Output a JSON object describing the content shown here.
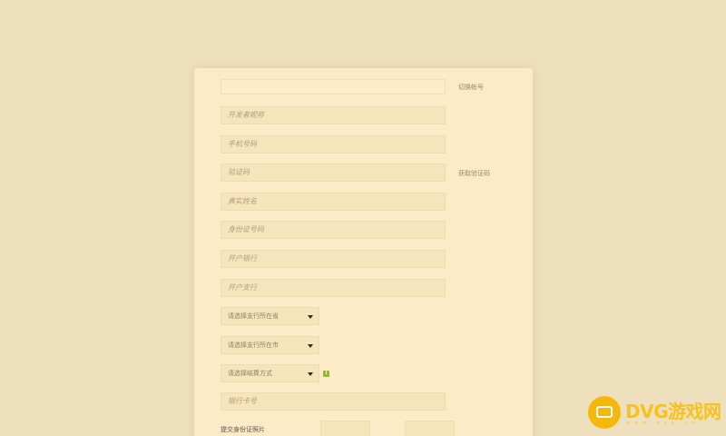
{
  "form": {
    "top_field": {
      "value": ""
    },
    "switch_account": "切换帐号",
    "fields": [
      {
        "placeholder": "开发者昵称"
      },
      {
        "placeholder": "手机号码"
      },
      {
        "placeholder": "验证码"
      },
      {
        "placeholder": "真实姓名"
      },
      {
        "placeholder": "身份证号码"
      },
      {
        "placeholder": "开户银行"
      },
      {
        "placeholder": "开户支行"
      }
    ],
    "get_code": "获取验证码",
    "selects": [
      {
        "value": "请选择支行所在省"
      },
      {
        "value": "请选择支行所在市"
      },
      {
        "value": "请选择结算方式"
      }
    ],
    "help_icon": "i",
    "bank_card": {
      "placeholder": "银行卡号"
    },
    "upload_label": "提交身份证照片"
  },
  "watermark": {
    "brand": "DVG游戏网",
    "sub": "www.dvg.cn",
    "brand_color": "#f4b80c"
  },
  "colors": {
    "background": "#efe0bd",
    "card": "#fcebc6",
    "field": "#f6e4bb"
  }
}
